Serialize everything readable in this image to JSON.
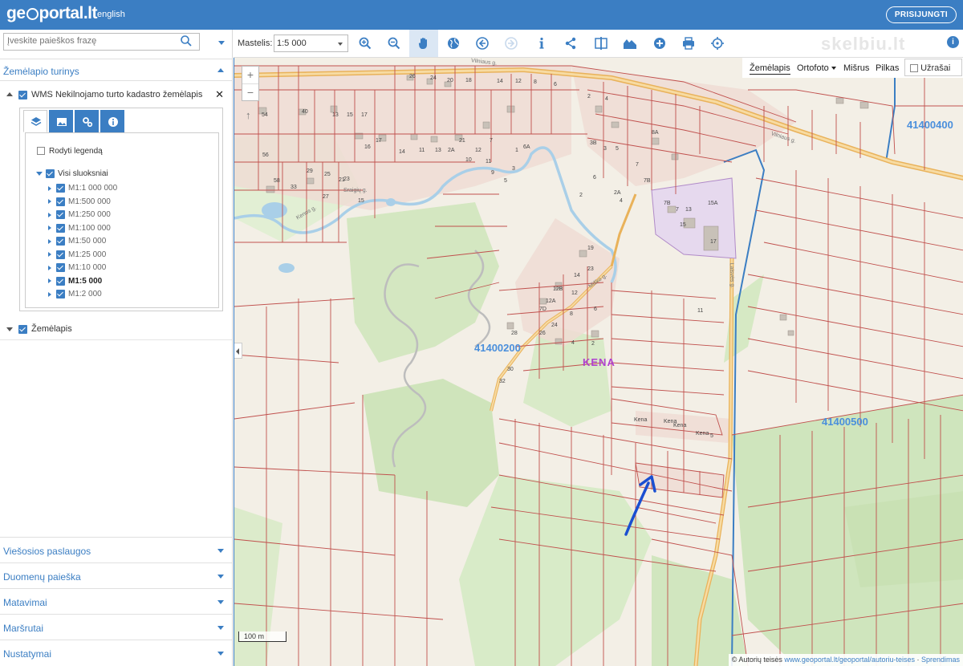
{
  "header": {
    "logo_text_a": "ge",
    "logo_text_b": "portal.lt",
    "lang": "english",
    "login": "PRISIJUNGTI"
  },
  "sidebar": {
    "search_placeholder": "Įveskite paieškos frazę",
    "content_title": "Žemėlapio turinys",
    "wms_layer": "WMS Nekilnojamo turto kadastro žemėlapis",
    "legend_label": "Rodyti legendą",
    "all_layers_label": "Visi sluoksniai",
    "scales": [
      {
        "label": "M1:1 000 000",
        "bold": false
      },
      {
        "label": "M1:500 000",
        "bold": false
      },
      {
        "label": "M1:250 000",
        "bold": false
      },
      {
        "label": "M1:100 000",
        "bold": false
      },
      {
        "label": "M1:50 000",
        "bold": false
      },
      {
        "label": "M1:25 000",
        "bold": false
      },
      {
        "label": "M1:10 000",
        "bold": false
      },
      {
        "label": "M1:5 000",
        "bold": true
      },
      {
        "label": "M1:2 000",
        "bold": false
      }
    ],
    "zemelapis_label": "Žemėlapis",
    "accordion": [
      "Viešosios paslaugos",
      "Duomenų paieška",
      "Matavimai",
      "Maršrutai",
      "Nustatymai"
    ]
  },
  "toolbar": {
    "mastelis_label": "Mastelis:",
    "mastelis_value": "1:5 000",
    "tools": [
      "zoom-in-icon",
      "zoom-out-icon",
      "pan-hand-icon",
      "globe-icon",
      "back-arrow-icon",
      "forward-arrow-icon",
      "info-icon",
      "share-icon",
      "compare-icon",
      "profile-icon",
      "add-icon",
      "print-icon",
      "locate-icon"
    ]
  },
  "watermark": "skelbiu.lt",
  "map": {
    "layers": [
      "Žemėlapis",
      "Ortofoto",
      "Mišrus",
      "Pilkas"
    ],
    "active_layer": "Žemėlapis",
    "uzrasai_label": "Užrašai",
    "zoom_plus": "+",
    "zoom_minus": "−",
    "north": "↑",
    "scalebar": "100 m",
    "attribution_prefix": "© Autorių teisės",
    "attribution_link": "www.geoportal.lt/geoportal/autoriu-teises",
    "attribution_suffix": "Sprendimas",
    "region_labels": [
      "41400400",
      "41400200",
      "41400500"
    ],
    "village_label": "KENA",
    "streets": [
      "Vilniaus g.",
      "Kenos g.",
      "Sraigių g.",
      "Laisvės g.",
      "Miško g."
    ],
    "parcel_labels": [
      "26",
      "24",
      "20",
      "18",
      "14",
      "12",
      "8",
      "6",
      "2",
      "4",
      "54",
      "40",
      "13",
      "15",
      "17",
      "16",
      "56",
      "29",
      "25",
      "23",
      "58",
      "33",
      "27",
      "21",
      "15",
      "17",
      "14",
      "11",
      "13",
      "2A",
      "21",
      "10",
      "12",
      "7",
      "11",
      "9",
      "5",
      "3",
      "1",
      "6A",
      "8A",
      "3B",
      "3",
      "5",
      "7",
      "7B",
      "6",
      "2",
      "2A",
      "4",
      "7B",
      "7",
      "13",
      "15",
      "15A",
      "17",
      "19",
      "23",
      "14",
      "12",
      "12B",
      "12A",
      "7D",
      "24",
      "26",
      "28",
      "30",
      "32",
      "8",
      "6",
      "4",
      "2",
      "11",
      "Kena",
      "Kena",
      "Kena",
      "Kena",
      "5"
    ]
  },
  "colors": {
    "brand_blue": "#3b7ec3",
    "parcel_line": "#c0504d",
    "road": "#e9b25a",
    "field_green": "#d8ebc8",
    "forest_green": "#c2dfac",
    "residential_pink": "#efdcd4",
    "water": "#a9cfe8",
    "admin_boundary": "#3b7ec3",
    "annotation_arrow": "#1a4fd1",
    "village_label": "#b040d0"
  }
}
